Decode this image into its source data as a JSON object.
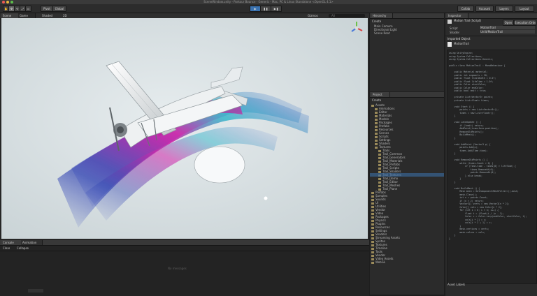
{
  "window": {
    "title": "SceneWindow.unity - Parkour Bounce - Generic - Mac, PC & Linux Standalone <OpenGL 4.1>"
  },
  "toolbar": {
    "tools": [
      "✋",
      "✥",
      "⟲",
      "⤢",
      "▭"
    ],
    "pivot": "Pivot",
    "global": "Global",
    "play": "▶",
    "pause": "❚❚",
    "step": "▶❚",
    "collab": "Collab",
    "account": "Account",
    "layers": "Layers",
    "layout": "Layout"
  },
  "scene_view": {
    "tab_label": "Scene",
    "game_tab_label": "Game",
    "shading": "Shaded",
    "mode_2d": "2D",
    "gizmos": "Gizmos",
    "search_placeholder": "All"
  },
  "hierarchy": {
    "tab_label": "Hierarchy",
    "create": "Create",
    "items": [
      "Main Camera",
      "Directional Light",
      "Scene Root"
    ]
  },
  "project": {
    "tab_label": "Project",
    "create": "Create",
    "tree": [
      "Assets",
      "Animations",
      "Editor",
      "Materials",
      "Models",
      "Packages",
      "Prefabs",
      "Resources",
      "Scenes",
      "Scripts",
      "Settings",
      "Shaders",
      "Textures",
      "Trails",
      "Trail_Common",
      "Trail_Generators",
      "Trail_Materials",
      "Trail_Prefabs",
      "Trail_Scripts",
      "Trail_Shaders",
      "Trail_Textures",
      "Trail_Demo",
      "Trail_Editor",
      "Trail_Meshes",
      "Trail_Plane",
      "Prefabs",
      "Samples",
      "Sounds",
      "UI",
      "Utilities",
      "Vendor",
      "Video",
      "Packages",
      "Physics",
      "Plugins",
      "Resources",
      "Settings",
      "Shaders",
      "Streaming Assets",
      "Sprites",
      "Textures",
      "Timeline",
      "Tools",
      "Vendor",
      "Video Assets",
      "WebGL"
    ]
  },
  "inspector": {
    "tab_label": "Inspector",
    "object_name": "Motion Trail (Script)",
    "fields": [
      {
        "label": "Script",
        "value": "MotionTrail"
      },
      {
        "label": "Shader",
        "value": "Unlit/MotionTrail"
      }
    ],
    "section_imported": "Imported Object",
    "asset_name": "MotionTrail",
    "open_button": "Open",
    "execution_order": "Execution Order...",
    "asset_labels": "Asset Labels"
  },
  "code_lines": [
    "using UnityEngine;",
    "using System.Collections;",
    "using System.Collections.Generic;",
    "",
    "public class MotionTrail : MonoBehaviour {",
    "",
    "    public Material material;",
    "    public int segments = 20;",
    "    public float trailWidth = 0.5f;",
    "    public float lifeTime = 1.0f;",
    "    public Color startColor;",
    "    public Color endColor;",
    "    public bool emit = true;",
    "",
    "    private List<Vector3> points;",
    "    private List<float> times;",
    "",
    "    void Start () {",
    "        points = new List<Vector3>();",
    "        times = new List<float>();",
    "    }",
    "",
    "    void LateUpdate () {",
    "        if (!emit) return;",
    "        AddPoint(transform.position);",
    "        RemoveOldPoints();",
    "        BuildMesh();",
    "    }",
    "",
    "    void AddPoint (Vector3 p) {",
    "        points.Add(p);",
    "        times.Add(Time.time);",
    "    }",
    "",
    "    void RemoveOldPoints () {",
    "        while (times.Count > 0) {",
    "            if (Time.time - times[0] > lifeTime) {",
    "                times.RemoveAt(0);",
    "                points.RemoveAt(0);",
    "            } else break;",
    "        }",
    "    }",
    "",
    "    void BuildMesh () {",
    "        Mesh mesh = GetComponent<MeshFilter>().mesh;",
    "        mesh.Clear();",
    "        int n = points.Count;",
    "        if (n < 2) return;",
    "        Vector3[] verts = new Vector3[n * 2];",
    "        Color[] cols = new Color[n * 2];",
    "        for (int i = 0; i < n; i++) {",
    "            float t = (float)i / (n - 1);",
    "            Color c = Color.Lerp(endColor, startColor, t);",
    "            cols[i * 2] = c;",
    "            cols[i * 2 + 1] = c;",
    "        }",
    "        mesh.vertices = verts;",
    "        mesh.colors = cols;",
    "    }",
    "}"
  ],
  "console": {
    "tab_label": "Console",
    "animation_tab_label": "Animation",
    "clear": "Clear",
    "collapse": "Collapse",
    "empty_message": "No messages"
  },
  "colors": {
    "accent": "#3a72b0",
    "trail_blue": "#2a3fa8",
    "trail_magenta": "#d21ea8",
    "trail_cyan": "#2bb5c8"
  }
}
